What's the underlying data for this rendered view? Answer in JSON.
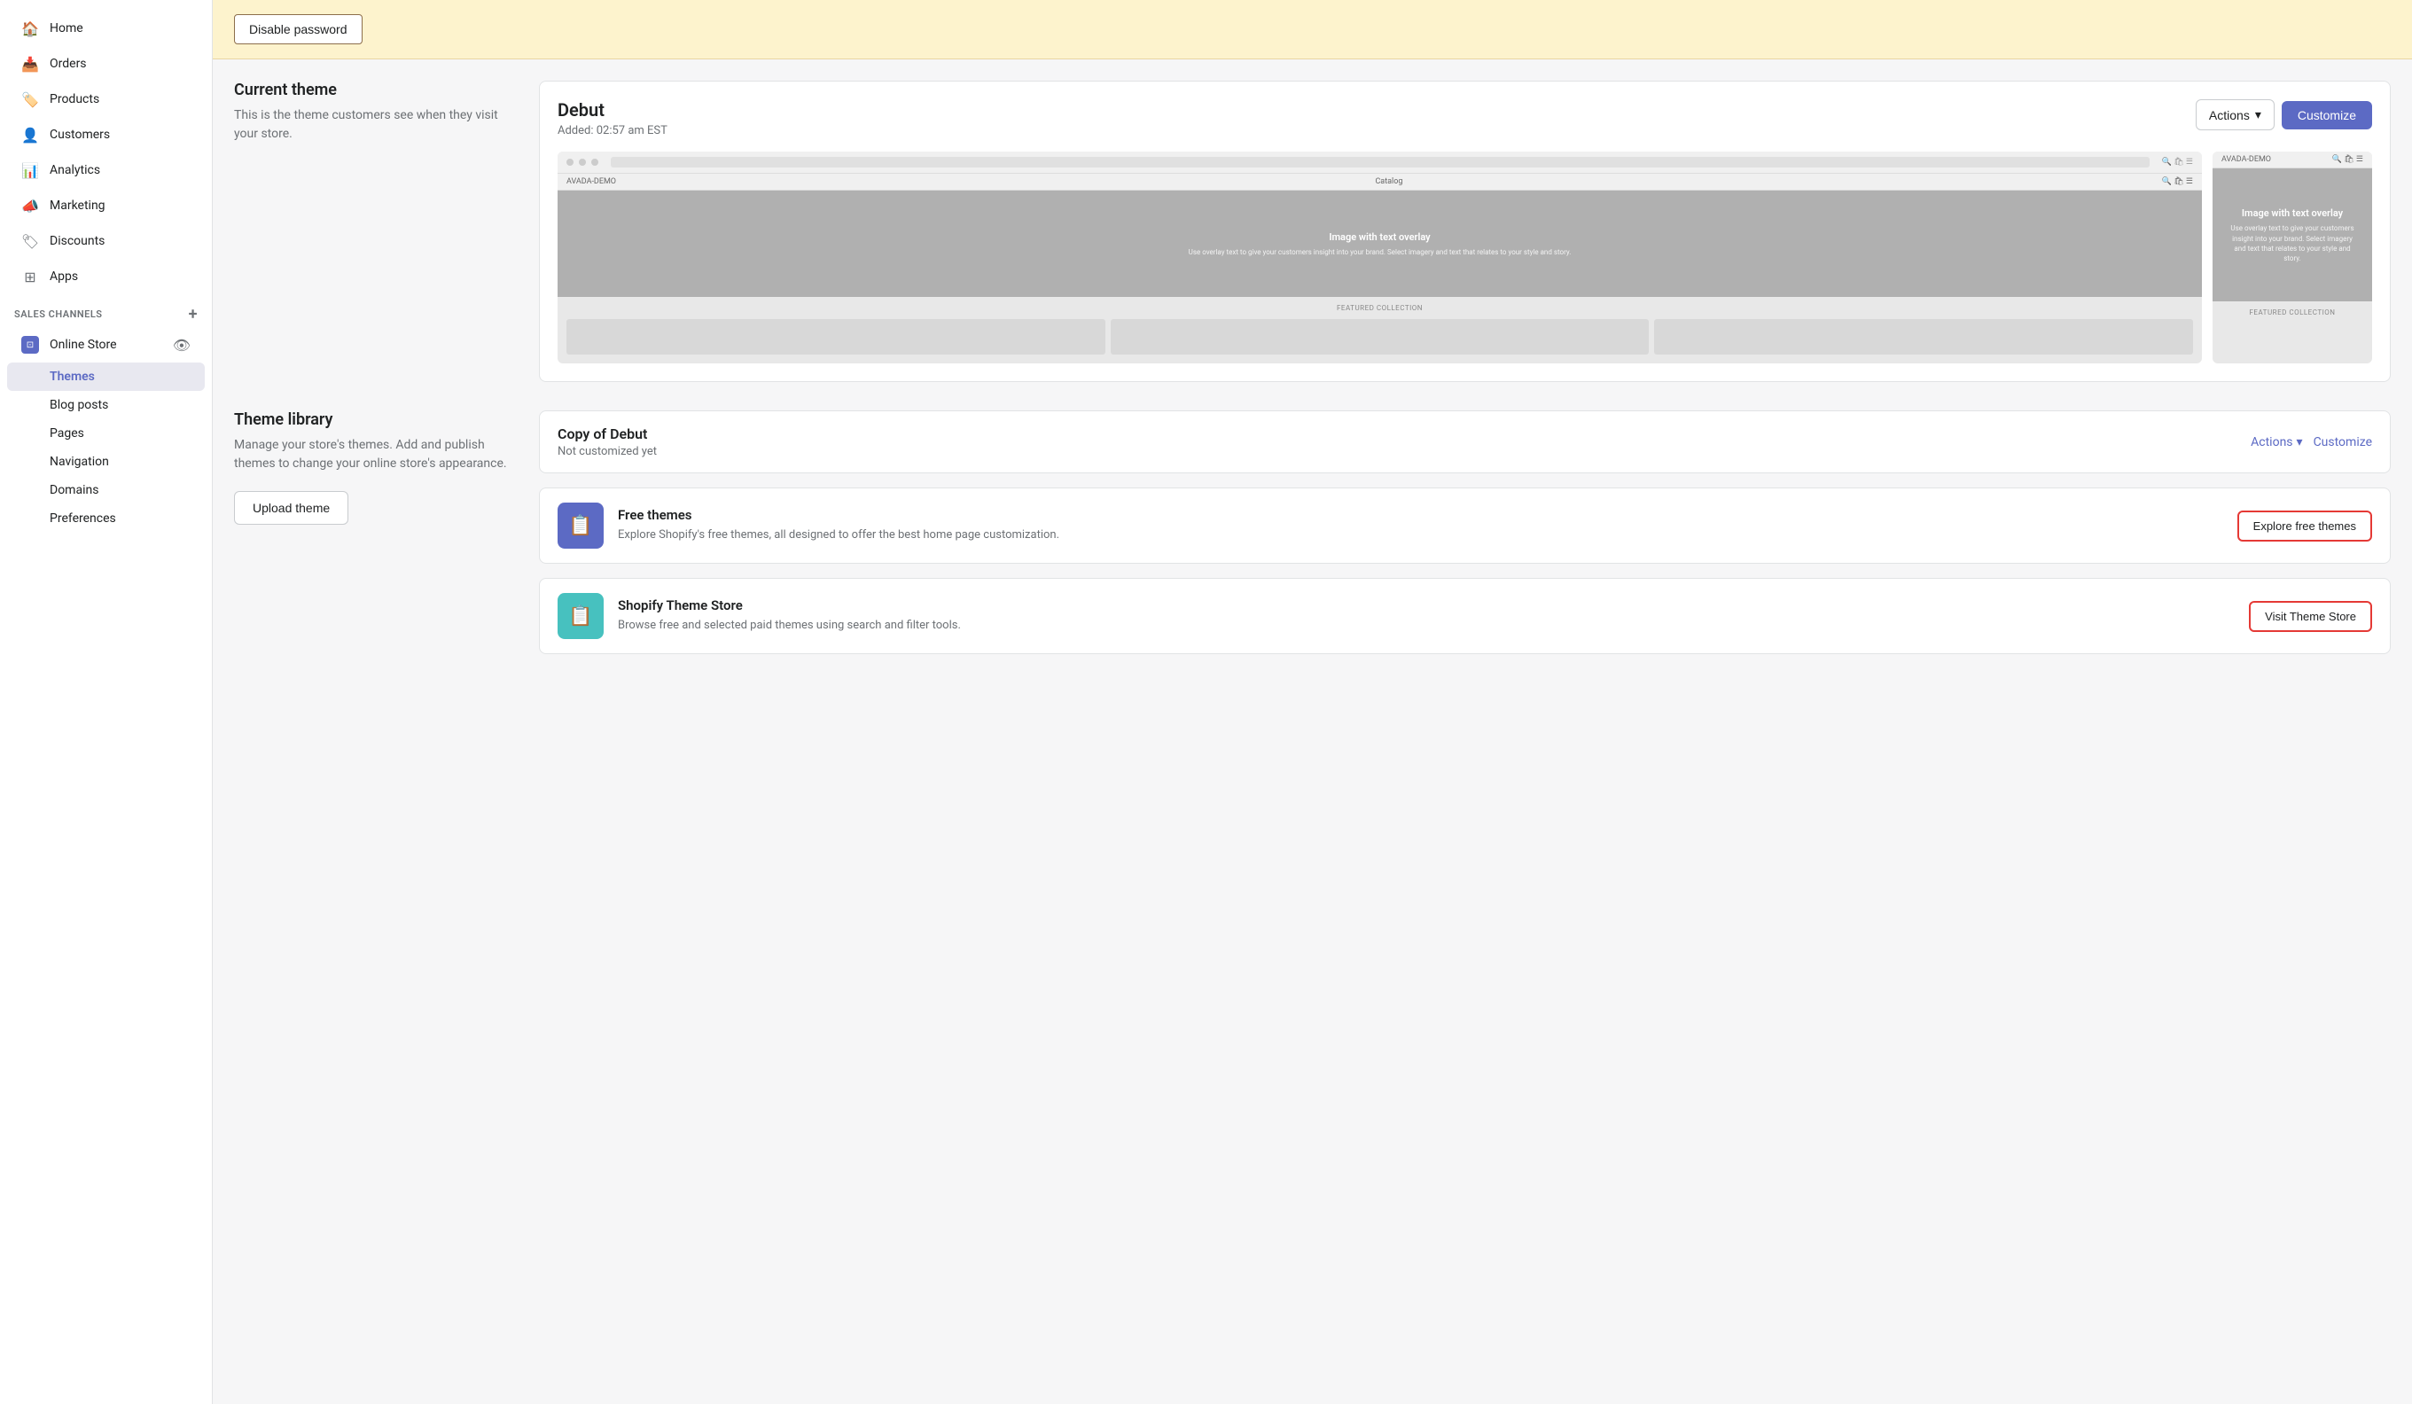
{
  "sidebar": {
    "nav_items": [
      {
        "id": "home",
        "label": "Home",
        "icon": "🏠"
      },
      {
        "id": "orders",
        "label": "Orders",
        "icon": "📥"
      },
      {
        "id": "products",
        "label": "Products",
        "icon": "🏷️"
      },
      {
        "id": "customers",
        "label": "Customers",
        "icon": "👤"
      },
      {
        "id": "analytics",
        "label": "Analytics",
        "icon": "📊"
      },
      {
        "id": "marketing",
        "label": "Marketing",
        "icon": "📣"
      },
      {
        "id": "discounts",
        "label": "Discounts",
        "icon": "🏷"
      },
      {
        "id": "apps",
        "label": "Apps",
        "icon": "⊞"
      }
    ],
    "sales_channels_label": "SALES CHANNELS",
    "online_store_label": "Online Store",
    "sub_items": [
      {
        "id": "themes",
        "label": "Themes",
        "active": true
      },
      {
        "id": "blog-posts",
        "label": "Blog posts",
        "active": false
      },
      {
        "id": "pages",
        "label": "Pages",
        "active": false
      },
      {
        "id": "navigation",
        "label": "Navigation",
        "active": false
      },
      {
        "id": "domains",
        "label": "Domains",
        "active": false
      },
      {
        "id": "preferences",
        "label": "Preferences",
        "active": false
      }
    ]
  },
  "password_banner": {
    "button_label": "Disable password"
  },
  "current_theme_section": {
    "title": "Current theme",
    "description": "This is the theme customers see when they visit your store.",
    "theme_name": "Debut",
    "theme_added": "Added: 02:57 am EST",
    "actions_label": "Actions",
    "customize_label": "Customize",
    "preview": {
      "desktop_nav": "AVADA-DEMO",
      "desktop_catalog": "Catalog",
      "desktop_hero_text": "Image with text overlay",
      "desktop_hero_sub": "Use overlay text to give your customers insight into your brand. Select imagery and text that relates to your style and story.",
      "desktop_featured": "FEATURED COLLECTION",
      "mobile_nav": "AVADA-DEMO",
      "mobile_hero_text": "Image with text overlay",
      "mobile_hero_sub": "Use overlay text to give your customers insight into your brand. Select imagery and text that relates to your style and story.",
      "mobile_featured": "FEATURED COLLECTION"
    }
  },
  "library_section": {
    "title": "Theme library",
    "description": "Manage your store's themes. Add and publish themes to change your online store's appearance.",
    "upload_button_label": "Upload theme",
    "copy_theme_name": "Copy of Debut",
    "copy_theme_status": "Not customized yet",
    "copy_actions_label": "Actions",
    "copy_customize_label": "Customize"
  },
  "resources": {
    "free_themes": {
      "icon": "📋",
      "title": "Free themes",
      "description": "Explore Shopify's free themes, all designed to offer the best home page customization.",
      "button_label": "Explore free themes"
    },
    "theme_store": {
      "icon": "📋",
      "title": "Shopify Theme Store",
      "description": "Browse free and selected paid themes using search and filter tools.",
      "button_label": "Visit Theme Store"
    }
  }
}
